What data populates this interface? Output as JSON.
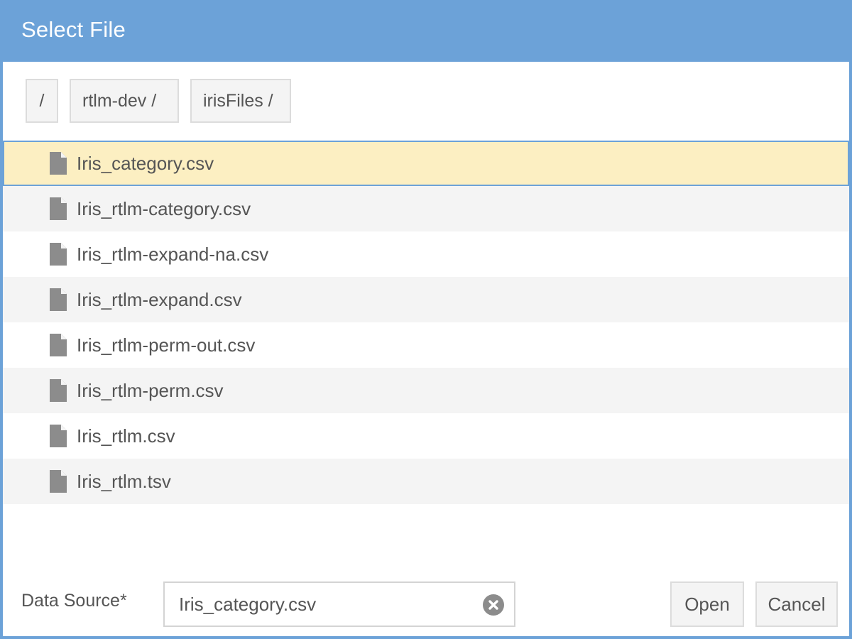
{
  "dialog": {
    "title": "Select File"
  },
  "breadcrumbs": [
    {
      "label": "/"
    },
    {
      "label": "rtlm-dev /"
    },
    {
      "label": "irisFiles /"
    }
  ],
  "files": [
    {
      "name": "Iris_category.csv",
      "selected": true
    },
    {
      "name": "Iris_rtlm-category.csv",
      "selected": false
    },
    {
      "name": "Iris_rtlm-expand-na.csv",
      "selected": false
    },
    {
      "name": "Iris_rtlm-expand.csv",
      "selected": false
    },
    {
      "name": "Iris_rtlm-perm-out.csv",
      "selected": false
    },
    {
      "name": "Iris_rtlm-perm.csv",
      "selected": false
    },
    {
      "name": "Iris_rtlm.csv",
      "selected": false
    },
    {
      "name": "Iris_rtlm.tsv",
      "selected": false
    }
  ],
  "footer": {
    "data_source_label": "Data Source*",
    "data_source_value": "Iris_category.csv",
    "open_label": "Open",
    "cancel_label": "Cancel"
  },
  "icons": {
    "file": "file-icon",
    "clear": "clear-circle-x-icon"
  },
  "colors": {
    "titlebar": "#6ca2d8",
    "selected_row": "#fcefc2",
    "selected_border": "#6ca2d8",
    "alt_row": "#f4f4f4",
    "icon_gray": "#8c8c8c"
  }
}
